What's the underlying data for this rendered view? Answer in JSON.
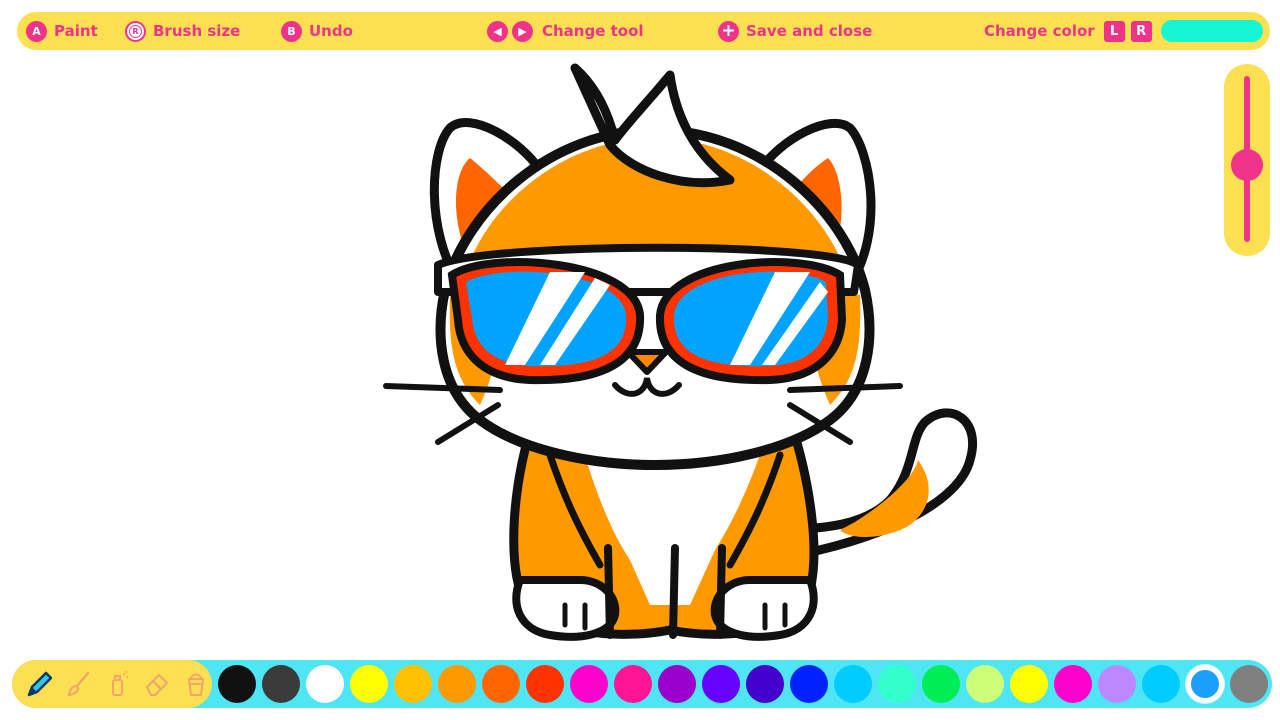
{
  "topbar": {
    "paint": {
      "button": "A",
      "label": "Paint"
    },
    "brush_size": {
      "button": "R",
      "label": "Brush size"
    },
    "undo": {
      "button": "B",
      "label": "Undo"
    },
    "change_tool": {
      "label": "Change tool"
    },
    "save": {
      "button": "+",
      "label": "Save and close"
    },
    "change_color": {
      "label": "Change color",
      "left_button": "L",
      "right_button": "R"
    },
    "current_color": "#14f5d3"
  },
  "brush_size": {
    "level": 0.5
  },
  "tools": [
    {
      "name": "pencil-icon",
      "selected": true
    },
    {
      "name": "paintbrush-icon",
      "selected": false
    },
    {
      "name": "spray-can-icon",
      "selected": false
    },
    {
      "name": "eraser-icon",
      "selected": false
    },
    {
      "name": "paint-bucket-icon",
      "selected": false
    }
  ],
  "palette": {
    "colors": [
      "#111111",
      "#3b3b3b",
      "#ffffff",
      "#ffff00",
      "#ffc000",
      "#ff9900",
      "#ff6600",
      "#ff3300",
      "#ff00cc",
      "#ff1493",
      "#9900cc",
      "#6600ff",
      "#4400cc",
      "#0022ff",
      "#00ccff",
      "#33ffcc",
      "#00ee55",
      "#ccff77",
      "#ffff00",
      "#ff00cc",
      "#bb88ff",
      "#00ccff",
      "#1a9fff",
      "#808080"
    ],
    "selected_index": 22
  },
  "colors": {
    "accent": "#f0338a",
    "bar_yellow": "#fbe052",
    "bar_cyan": "#4ee6f4",
    "cat_orange": "#ff9900",
    "lens_blue": "#00a3ff",
    "frame_red": "#ff3300"
  }
}
